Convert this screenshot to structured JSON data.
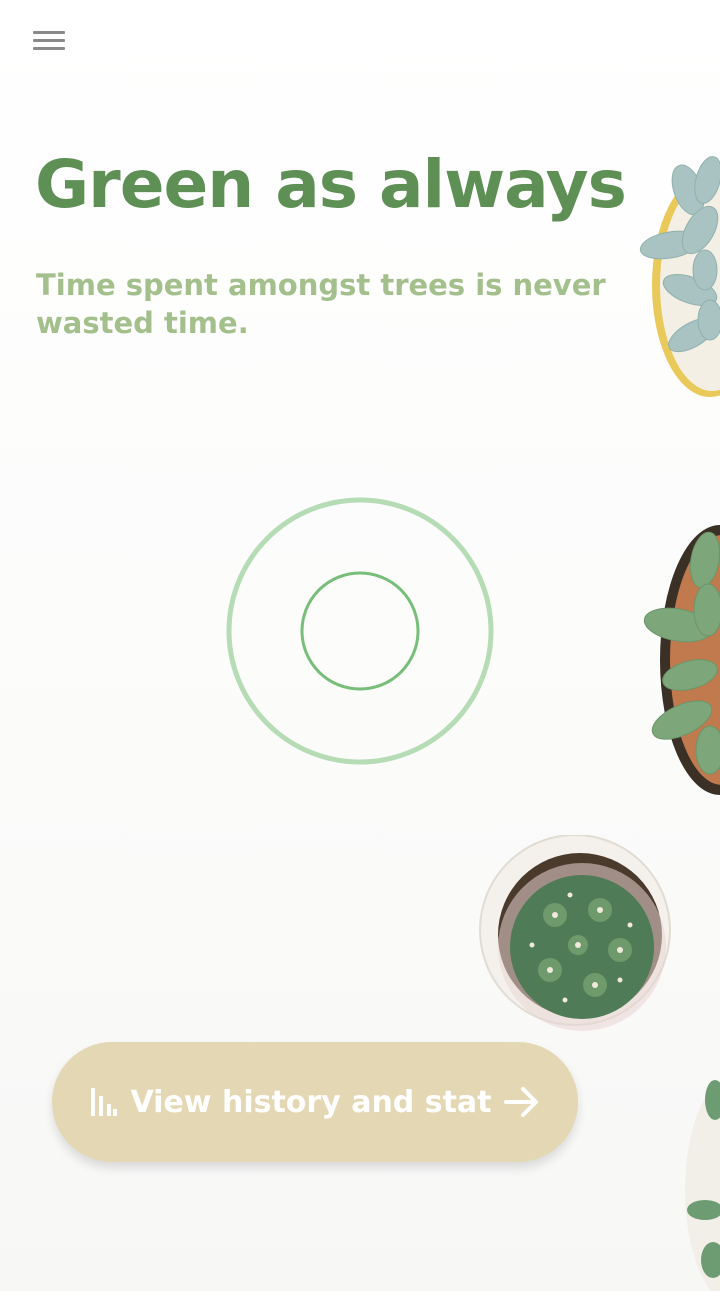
{
  "header": {
    "menu_icon": "hamburger-menu-icon"
  },
  "hero": {
    "title": "Green as always",
    "subtitle": "Time spent amongst trees is never wasted time."
  },
  "timer": {
    "icon": "timer-ring-icon"
  },
  "history_button": {
    "label": "View history and stat",
    "leading_icon": "bar-chart-icon",
    "trailing_icon": "arrow-right-icon"
  },
  "colors": {
    "title": "#5e8f55",
    "subtitle": "#a3c08c",
    "ring_outer": "#b5dcb4",
    "ring_inner": "#78be7a",
    "button_bg": "#e3d8b3",
    "button_text": "#ffffff",
    "menu_icon": "#8a8a8a"
  }
}
